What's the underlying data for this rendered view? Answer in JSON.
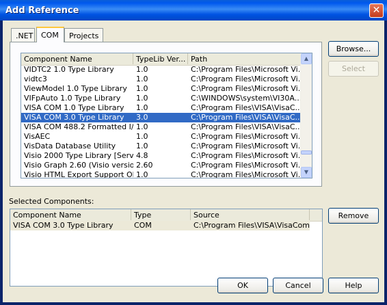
{
  "window": {
    "title": "Add Reference",
    "close_symbol": "✕"
  },
  "tabs": [
    {
      "label": ".NET",
      "active": false
    },
    {
      "label": "COM",
      "active": true
    },
    {
      "label": "Projects",
      "active": false
    }
  ],
  "components_list": {
    "columns": [
      "Component Name",
      "TypeLib Ver...",
      "Path"
    ],
    "rows": [
      {
        "name": "VIDTC2 1.0 Type Library",
        "version": "1.0",
        "path": "C:\\Program Files\\Microsoft Vi..."
      },
      {
        "name": "vidtc3",
        "version": "1.0",
        "path": "C:\\Program Files\\Microsoft Vi..."
      },
      {
        "name": "ViewModel 1.0 Type Library",
        "version": "1.0",
        "path": "C:\\Program Files\\Microsoft Vi..."
      },
      {
        "name": "VIFpAuto 1.0 Type Library",
        "version": "1.0",
        "path": "C:\\WINDOWS\\system\\VI30A..."
      },
      {
        "name": "VISA COM 1.0 Type Library",
        "version": "1.0",
        "path": "C:\\Program Files\\VISA\\VisaC..."
      },
      {
        "name": "VISA COM 3.0 Type Library",
        "version": "3.0",
        "path": "C:\\Program Files\\VISA\\VisaC...",
        "selected": true
      },
      {
        "name": "VISA COM 488.2 Formatted I/...",
        "version": "1.0",
        "path": "C:\\Program Files\\VISA\\VisaC..."
      },
      {
        "name": "VisAEC",
        "version": "1.0",
        "path": "C:\\Program Files\\Microsoft Vi..."
      },
      {
        "name": "VisData Database Utility",
        "version": "1.0",
        "path": "C:\\Program Files\\Microsoft Vi..."
      },
      {
        "name": "Visio 2000 Type Library [Servi...",
        "version": "4.8",
        "path": "C:\\Program Files\\Microsoft Vi..."
      },
      {
        "name": "Visio Graph 2.60 (Visio version...",
        "version": "2.60",
        "path": "C:\\Program Files\\Microsoft Vi..."
      },
      {
        "name": "Visio HTML Export Support Ob...",
        "version": "1.0",
        "path": "C:\\Program Files\\Microsoft Vi..."
      }
    ]
  },
  "buttons": {
    "browse": "Browse...",
    "select": "Select",
    "remove": "Remove",
    "ok": "OK",
    "cancel": "Cancel",
    "help": "Help"
  },
  "selected_components": {
    "label": "Selected Components:",
    "columns": [
      "Component Name",
      "Type",
      "Source"
    ],
    "rows": [
      {
        "name": "VISA COM 3.0 Type Library",
        "type": "COM",
        "source": "C:\\Program Files\\VISA\\VisaCom..."
      }
    ]
  },
  "colors": {
    "selection": "#316AC5",
    "dialog_bg": "#ECE9D8",
    "title_blue": "#0054E3"
  }
}
